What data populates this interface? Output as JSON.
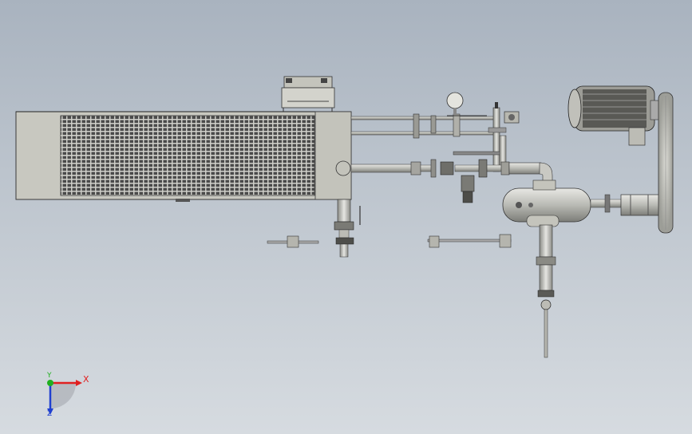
{
  "viewport": {
    "background_top": "#a9b3bf",
    "background_bottom": "#d6dbe0"
  },
  "model": {
    "part_color": "#c9cac4",
    "edge_color": "#3a3a3a",
    "dark_color": "#2a2a2a",
    "parts": [
      "heat-exchanger",
      "grille",
      "control-box",
      "inlet-pipe",
      "upper-rail",
      "gauge",
      "valve-assembly",
      "separator-tank",
      "motor",
      "coupling",
      "flywheel",
      "drain-pipe",
      "bottom-valve",
      "left-bracket",
      "mid-bracket"
    ]
  },
  "triad": {
    "x_label": "X",
    "y_label": "Y",
    "z_label": "Z",
    "x_color": "#e02020",
    "y_color": "#20b020",
    "z_color": "#2040d0"
  }
}
